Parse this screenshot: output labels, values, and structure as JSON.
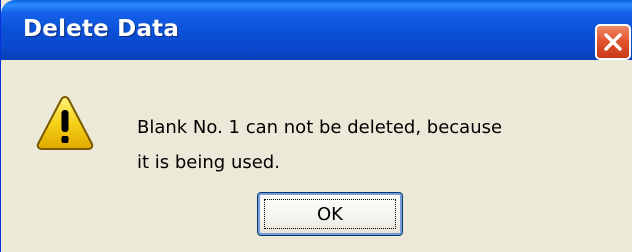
{
  "dialog": {
    "title": "Delete Data",
    "close_icon": "close-x-icon",
    "warning_icon": "warning-triangle-icon",
    "message_line1": "Blank No. 1 can not be deleted, because",
    "message_line2": "it is being used.",
    "ok_label": "OK"
  },
  "colors": {
    "titlebar": "#0a4fd6",
    "close_button": "#e2562f",
    "dialog_background": "#ece9d8",
    "warning_fill": "#f6d11a"
  }
}
